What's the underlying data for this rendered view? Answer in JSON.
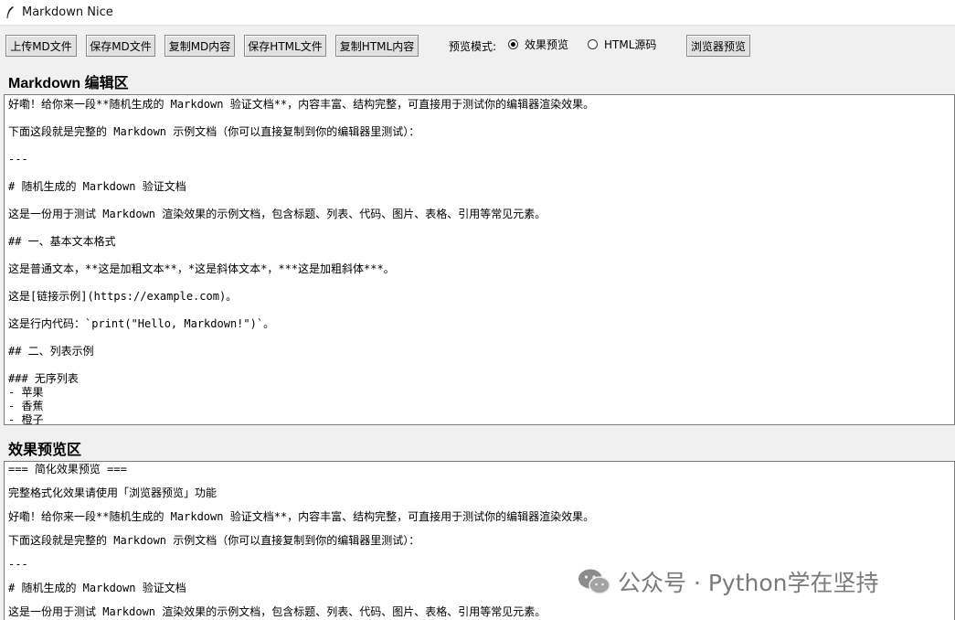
{
  "window": {
    "title": "Markdown Nice",
    "app_icon": "feather-icon"
  },
  "toolbar": {
    "upload_md": "上传MD文件",
    "save_md": "保存MD文件",
    "copy_md": "复制MD内容",
    "save_html": "保存HTML文件",
    "copy_html": "复制HTML内容",
    "preview_mode_label": "预览模式:",
    "mode_effect": "效果预览",
    "mode_html": "HTML源码",
    "selected_mode": "效果预览",
    "browser_preview": "浏览器预览"
  },
  "editor": {
    "heading": "Markdown 编辑区",
    "lines": [
      "好嘞！给你来一段**随机生成的 Markdown 验证文档**，内容丰富、结构完整，可直接用于测试你的编辑器渲染效果。",
      "",
      "下面这段就是完整的 Markdown 示例文档（你可以直接复制到你的编辑器里测试）：",
      "",
      "---",
      "",
      "# 随机生成的 Markdown 验证文档",
      "",
      "这是一份用于测试 Markdown 渲染效果的示例文档，包含标题、列表、代码、图片、表格、引用等常见元素。",
      "",
      "## 一、基本文本格式",
      "",
      "这是普通文本，**这是加粗文本**，*这是斜体文本*，***这是加粗斜体***。",
      "",
      "这是[链接示例](https://example.com)。",
      "",
      "这是行内代码：`print(\"Hello, Markdown!\")`。",
      "",
      "## 二、列表示例",
      "",
      "### 无序列表",
      "- 苹果",
      "- 香蕉",
      "- 橙子"
    ]
  },
  "preview": {
    "heading": "效果预览区",
    "lines": [
      "=== 简化效果预览 ===",
      "",
      "完整格式化效果请使用「浏览器预览」功能",
      "",
      "好嘞！给你来一段**随机生成的 Markdown 验证文档**，内容丰富、结构完整，可直接用于测试你的编辑器渲染效果。",
      "",
      "下面这段就是完整的 Markdown 示例文档（你可以直接复制到你的编辑器里测试）：",
      "",
      "---",
      "",
      "# 随机生成的 Markdown 验证文档",
      "",
      "这是一份用于测试 Markdown 渲染效果的示例文档，包含标题、列表、代码、图片、表格、引用等常见元素。"
    ]
  },
  "watermark": {
    "text": "公众号 · Python学在坚持",
    "icon": "wechat-icon"
  }
}
